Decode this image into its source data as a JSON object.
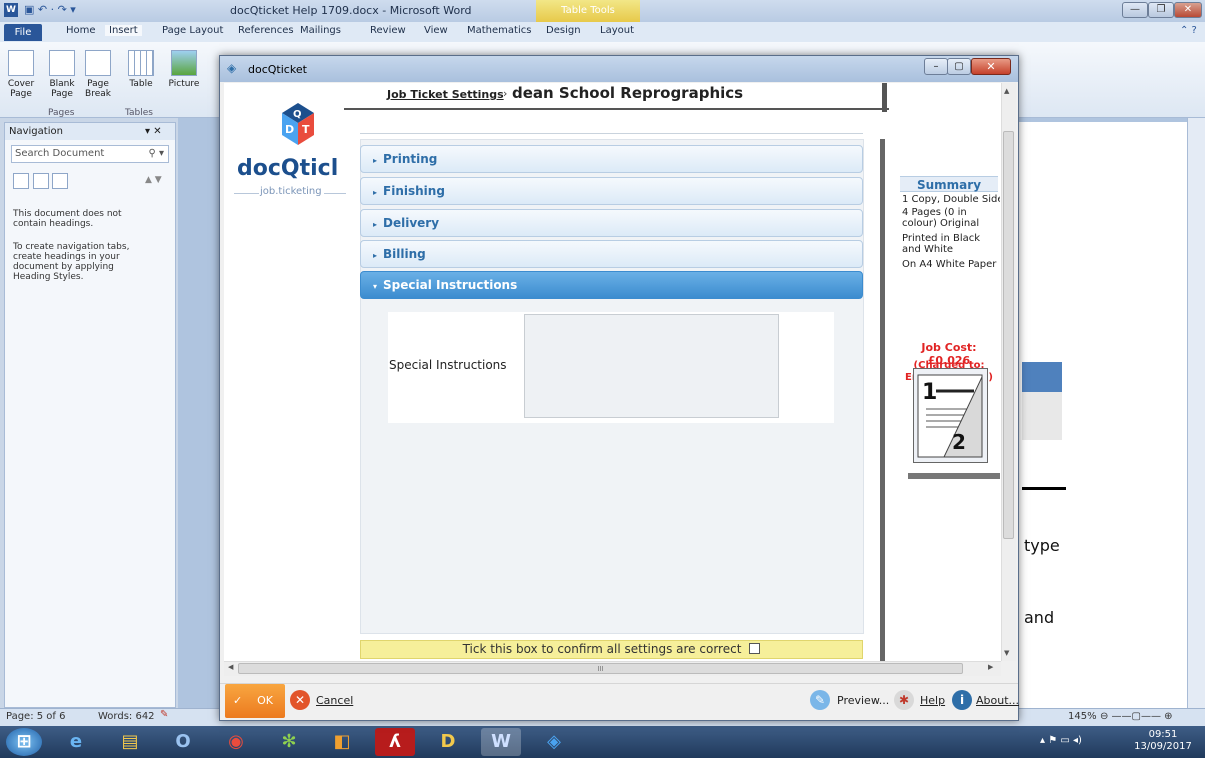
{
  "word": {
    "title": "docQticket Help 1709.docx - Microsoft Word",
    "table_tools": "Table Tools",
    "tabs": [
      "Home",
      "Insert",
      "Page Layout",
      "References",
      "Mailings",
      "Review",
      "View",
      "Mathematics",
      "Design",
      "Layout"
    ],
    "file_tab": "File",
    "ribbon": {
      "cover_page": "Cover Page",
      "blank_page": "Blank Page",
      "page_break": "Page Break",
      "table": "Table",
      "picture": "Picture",
      "group_pages": "Pages",
      "group_tables": "Tables"
    },
    "doc_fragments": [
      "type",
      "and"
    ]
  },
  "navigation": {
    "header": "Navigation",
    "search_placeholder": "Search Document",
    "msg1": "This document does not contain headings.",
    "msg2": "To create navigation tabs, create headings in your document by applying Heading Styles."
  },
  "status": {
    "page": "Page: 5 of 6",
    "words": "Words: 642",
    "zoom": "145%"
  },
  "taskbar": {
    "time": "09:51",
    "date": "13/09/2017"
  },
  "dialog": {
    "title": "docQticket",
    "logo": "docQticl",
    "logo_sub": "job.ticketing",
    "breadcrumb": "Job Ticket Settings",
    "org": "dean School Reprographics",
    "sections": [
      "Printing",
      "Finishing",
      "Delivery",
      "Billing",
      "Special Instructions"
    ],
    "si_label": "Special Instructions",
    "confirm": "Tick this box to confirm all settings are correct",
    "summary": {
      "title": "Summary",
      "lines": [
        "1 Copy, Double Sided",
        "4 Pages (0 in colour) Original",
        "Printed in Black and White",
        "On A4 White Paper"
      ],
      "job_cost": "Job Cost: £0.026",
      "charged": "(Charged to: English Staff – )"
    },
    "footer": {
      "ok": "OK",
      "cancel": "Cancel",
      "preview": "Preview...",
      "help": "Help",
      "about": "About..."
    },
    "hscroll_mark": "III"
  },
  "colors": {
    "accent_blue": "#3c8ccf",
    "ok_orange": "#ec7a1f",
    "cost_red": "#e12424",
    "confirm_yellow": "#f6ef9a"
  }
}
